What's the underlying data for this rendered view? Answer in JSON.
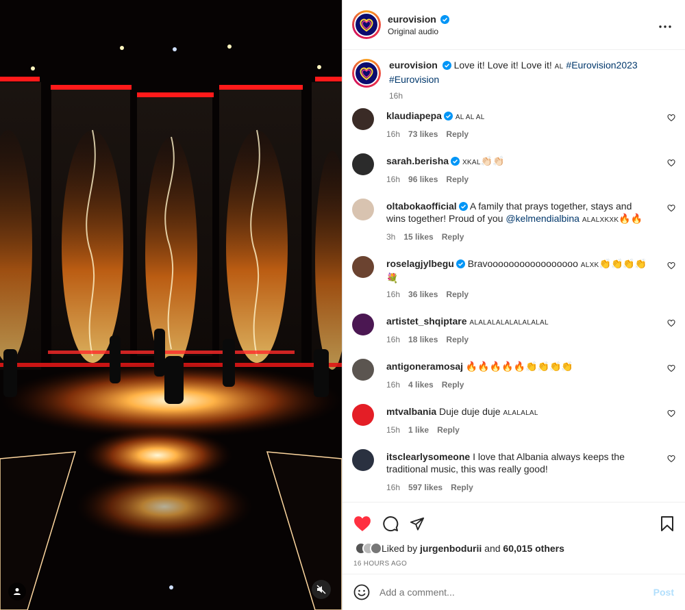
{
  "header": {
    "username": "eurovision",
    "audio": "Original audio"
  },
  "caption": {
    "username": "eurovision",
    "text": "Love it! Love it! Love it!",
    "flag": "AL",
    "hashtag1": "#Eurovision2023",
    "hashtag2": "#Eurovision",
    "time": "16h"
  },
  "comments": [
    {
      "username": "klaudiapepa",
      "verified": true,
      "pre": "",
      "text": "",
      "mention": "",
      "post": "",
      "flags": "AL AL AL",
      "emoji": "",
      "time": "16h",
      "likes": "73 likes",
      "reply": "Reply",
      "avatar_color": "#3a2b26"
    },
    {
      "username": "sarah.berisha",
      "verified": true,
      "pre": "",
      "text": "",
      "mention": "",
      "post": "",
      "flags": "XKAL",
      "emoji": "👏🏻👏🏻",
      "time": "16h",
      "likes": "96 likes",
      "reply": "Reply",
      "avatar_color": "#2b2b2b"
    },
    {
      "username": "oltabokaofficial",
      "verified": true,
      "pre": "",
      "text": "A family that prays together, stays and wins together! Proud of you",
      "mention": "@kelmendialbina",
      "post": "",
      "flags": "ALALXKXK",
      "emoji": "🔥🔥",
      "time": "3h",
      "likes": "15 likes",
      "reply": "Reply",
      "avatar_color": "#d8c3b0"
    },
    {
      "username": "roselagjylbegu",
      "verified": true,
      "pre": "",
      "text": "Bravooooooooooooooooo",
      "mention": "",
      "post": "",
      "flags": "ALXK",
      "emoji": "👏👏👏👏",
      "emoji2": "💐",
      "time": "16h",
      "likes": "36 likes",
      "reply": "Reply",
      "avatar_color": "#6b4330"
    },
    {
      "username": "artistet_shqiptare",
      "verified": false,
      "pre": "",
      "text": "",
      "mention": "",
      "post": "",
      "flags": "ALALALALALALALALAL",
      "emoji": "",
      "time": "16h",
      "likes": "18 likes",
      "reply": "Reply",
      "avatar_color": "#4b1752"
    },
    {
      "username": "antigoneramosaj",
      "verified": false,
      "pre": "",
      "text": "",
      "mention": "",
      "post": "",
      "flags": "",
      "emoji": "🔥🔥🔥🔥🔥👏👏👏👏",
      "time": "16h",
      "likes": "4 likes",
      "reply": "Reply",
      "avatar_color": "#5b5550"
    },
    {
      "username": "mtvalbania",
      "verified": false,
      "pre": "",
      "text": "Duje duje duje",
      "mention": "",
      "post": "",
      "flags": "ALALALAL",
      "emoji": "",
      "time": "15h",
      "likes": "1 like",
      "reply": "Reply",
      "avatar_color": "#e41e26"
    },
    {
      "username": "itsclearlysomeone",
      "verified": false,
      "pre": "",
      "text": "I love that Albania always keeps the traditional music, this was really good!",
      "mention": "",
      "post": "",
      "flags": "",
      "emoji": "",
      "time": "16h",
      "likes": "597 likes",
      "reply": "Reply",
      "avatar_color": "#2a3140"
    }
  ],
  "likes": {
    "prefix": "Liked by",
    "user": "jurgenbodurii",
    "and": "and",
    "count": "60,015 others"
  },
  "time_ago": "16 HOURS AGO",
  "add_comment": {
    "placeholder": "Add a comment...",
    "post_label": "Post"
  },
  "colors": {
    "like_red": "#ff3040",
    "link_blue": "#00376b",
    "verified_blue": "#0095f6",
    "post_disabled": "#b2dffc"
  }
}
